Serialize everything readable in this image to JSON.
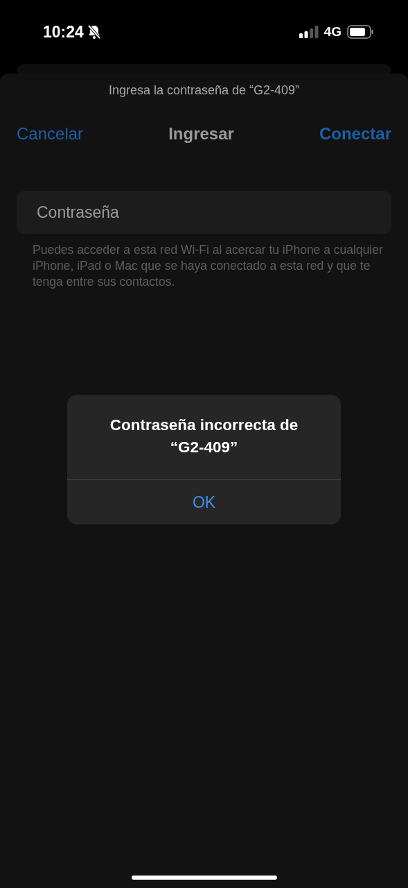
{
  "status_bar": {
    "time": "10:24",
    "network": "4G"
  },
  "sheet": {
    "prompt": "Ingresa la contraseña de “G2-409”",
    "cancel": "Cancelar",
    "title": "Ingresar",
    "connect": "Conectar"
  },
  "password_field": {
    "placeholder": "Contraseña"
  },
  "hint": "Puedes acceder a esta red Wi-Fi al acercar tu iPhone a cualquier iPhone, iPad o Mac que se haya conectado a esta red y que te tenga entre sus contactos.",
  "alert": {
    "title": "Contraseña incorrecta de “G2-409”",
    "button": "OK"
  }
}
